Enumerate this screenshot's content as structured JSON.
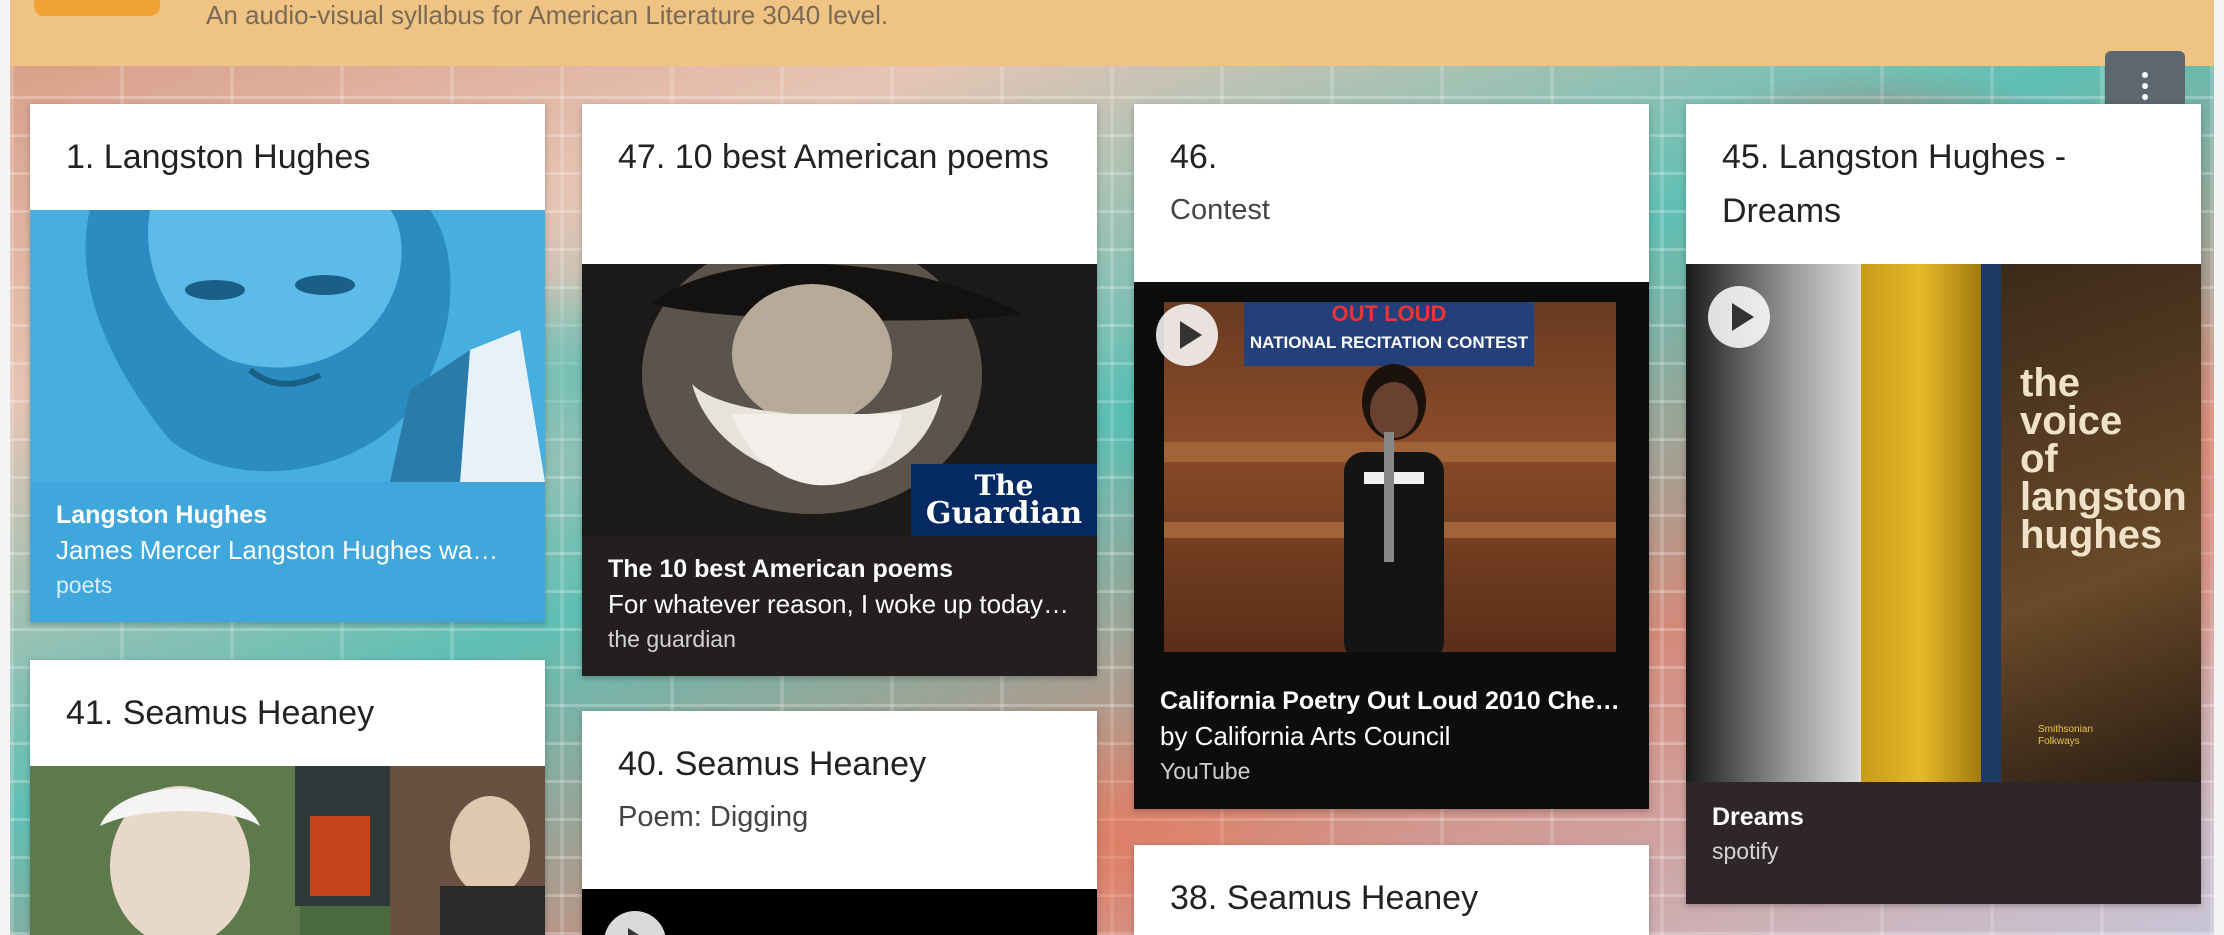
{
  "header": {
    "subtitle": "An audio-visual syllabus for American Literature 3040 level."
  },
  "menu": {
    "icon": "more-vertical-icon"
  },
  "cards": {
    "c1": {
      "title": "1. Langston Hughes",
      "caption_title": "Langston Hughes",
      "caption_sub": "James Mercer Langston Hughes wa…",
      "caption_src": "poets"
    },
    "c47": {
      "title": "47. 10 best American poems",
      "logo_line1": "The",
      "logo_line2": "Guardian",
      "caption_title": "The 10 best American poems",
      "caption_sub": "For whatever reason, I woke up today…",
      "caption_src": "the guardian"
    },
    "c46": {
      "title": "46.",
      "desc": "Contest",
      "banner": "OUT LOUD",
      "banner_sub": "NATIONAL RECITATION CONTEST",
      "caption_title": "California Poetry Out Loud 2010 Che…",
      "caption_sub": "by California Arts Council",
      "caption_src": "YouTube"
    },
    "c45": {
      "title": "45. Langston Hughes - Dreams",
      "album_text": "the voice of langston hughes",
      "album_label": "Smithsonian Folkways",
      "caption_title": "Dreams",
      "caption_src": "spotify"
    },
    "c41": {
      "title": "41.  Seamus Heaney"
    },
    "c40": {
      "title": "40.  Seamus Heaney",
      "desc": "Poem: Digging"
    },
    "c38": {
      "title": "38.  Seamus Heaney"
    }
  }
}
